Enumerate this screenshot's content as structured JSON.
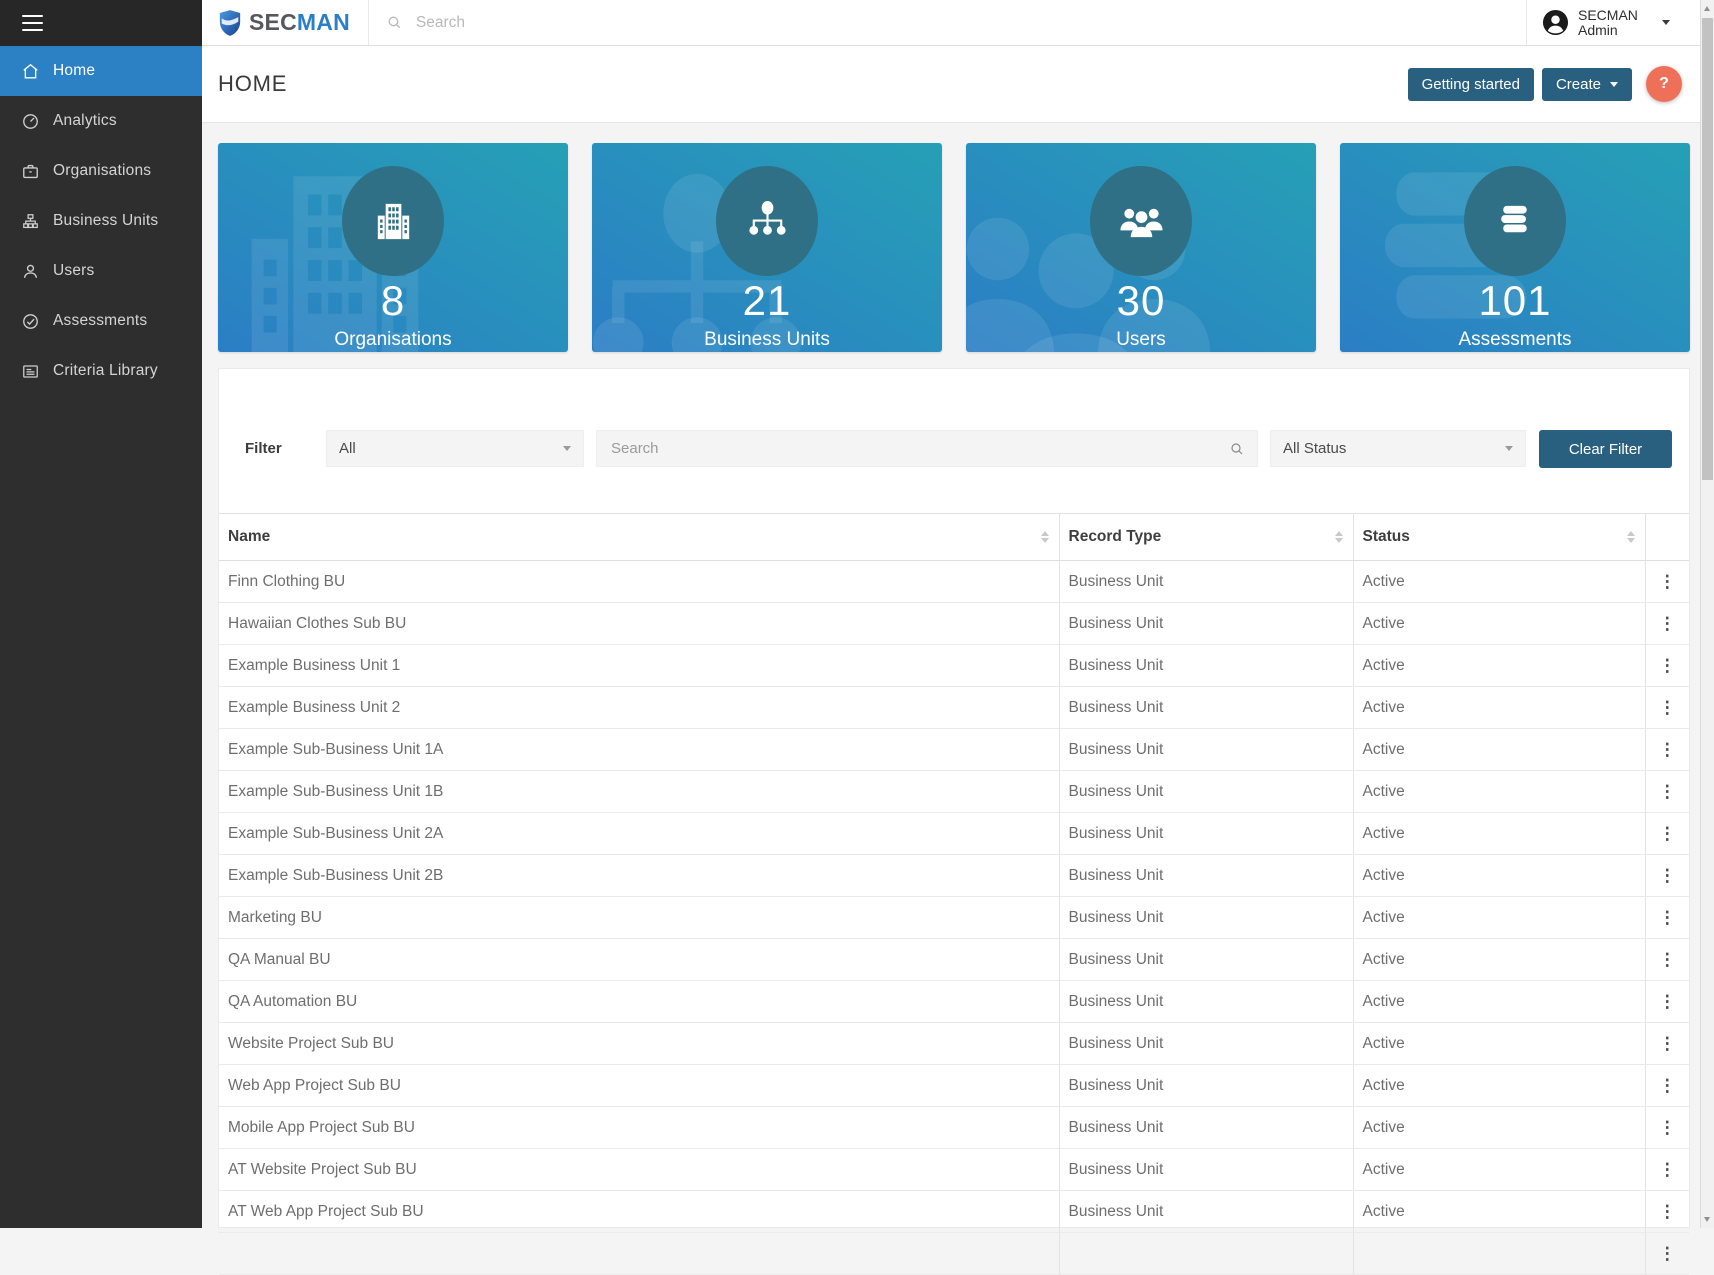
{
  "topbar": {
    "logo_sec": "SEC",
    "logo_man": "MAN",
    "search_placeholder": "Search",
    "user_line1": "SECMAN",
    "user_line2": "Admin"
  },
  "sidebar": {
    "items": [
      {
        "label": "Home"
      },
      {
        "label": "Analytics"
      },
      {
        "label": "Organisations"
      },
      {
        "label": "Business Units"
      },
      {
        "label": "Users"
      },
      {
        "label": "Assessments"
      },
      {
        "label": "Criteria Library"
      }
    ]
  },
  "header": {
    "title": "HOME",
    "getting_started_label": "Getting started",
    "create_label": "Create",
    "help_label": "?"
  },
  "stats": [
    {
      "value": "8",
      "label": "Organisations",
      "icon": "building-icon"
    },
    {
      "value": "21",
      "label": "Business Units",
      "icon": "sitemap-icon"
    },
    {
      "value": "30",
      "label": "Users",
      "icon": "people-icon"
    },
    {
      "value": "101",
      "label": "Assessments",
      "icon": "books-icon"
    }
  ],
  "filter": {
    "label": "Filter",
    "type_value": "All",
    "search_placeholder": "Search",
    "status_value": "All Status",
    "clear_label": "Clear Filter"
  },
  "table": {
    "columns": [
      "Name",
      "Record Type",
      "Status"
    ],
    "rows": [
      {
        "name": "Finn Clothing BU",
        "record_type": "Business Unit",
        "status": "Active"
      },
      {
        "name": "Hawaiian Clothes Sub BU",
        "record_type": "Business Unit",
        "status": "Active"
      },
      {
        "name": "Example Business Unit 1",
        "record_type": "Business Unit",
        "status": "Active"
      },
      {
        "name": "Example Business Unit 2",
        "record_type": "Business Unit",
        "status": "Active"
      },
      {
        "name": "Example Sub-Business Unit 1A",
        "record_type": "Business Unit",
        "status": "Active"
      },
      {
        "name": "Example Sub-Business Unit 1B",
        "record_type": "Business Unit",
        "status": "Active"
      },
      {
        "name": "Example Sub-Business Unit 2A",
        "record_type": "Business Unit",
        "status": "Active"
      },
      {
        "name": "Example Sub-Business Unit 2B",
        "record_type": "Business Unit",
        "status": "Active"
      },
      {
        "name": "Marketing BU",
        "record_type": "Business Unit",
        "status": "Active"
      },
      {
        "name": "QA Manual BU",
        "record_type": "Business Unit",
        "status": "Active"
      },
      {
        "name": "QA Automation BU",
        "record_type": "Business Unit",
        "status": "Active"
      },
      {
        "name": "Website Project Sub BU",
        "record_type": "Business Unit",
        "status": "Active"
      },
      {
        "name": "Web App Project Sub BU",
        "record_type": "Business Unit",
        "status": "Active"
      },
      {
        "name": "Mobile App Project Sub BU",
        "record_type": "Business Unit",
        "status": "Active"
      },
      {
        "name": "AT Website Project Sub BU",
        "record_type": "Business Unit",
        "status": "Active"
      },
      {
        "name": "AT Web App Project Sub BU",
        "record_type": "Business Unit",
        "status": "Active"
      }
    ]
  },
  "colors": {
    "active_blue": "#2c80c4",
    "button_teal": "#29607f",
    "help_coral": "#ef7059",
    "card_gradient_start": "#2b7ec5",
    "card_gradient_end": "#26a0b6",
    "card_circle": "#2f7086",
    "sidebar_bg": "#2e2e2e"
  }
}
